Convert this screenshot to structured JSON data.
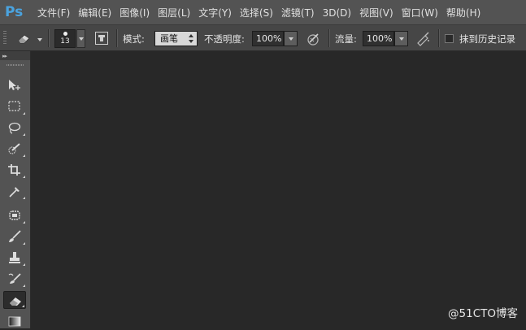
{
  "app": {
    "logo": "Ps"
  },
  "menu": {
    "items": [
      {
        "label": "文件(F)"
      },
      {
        "label": "编辑(E)"
      },
      {
        "label": "图像(I)"
      },
      {
        "label": "图层(L)"
      },
      {
        "label": "文字(Y)"
      },
      {
        "label": "选择(S)"
      },
      {
        "label": "滤镜(T)"
      },
      {
        "label": "3D(D)"
      },
      {
        "label": "视图(V)"
      },
      {
        "label": "窗口(W)"
      },
      {
        "label": "帮助(H)"
      }
    ]
  },
  "options": {
    "tool_icon": "eraser-icon",
    "brush_size": "13",
    "mode_label": "模式:",
    "mode_value": "画笔",
    "opacity_label": "不透明度:",
    "opacity_value": "100%",
    "flow_label": "流量:",
    "flow_value": "100%",
    "erase_history_label": "抹到历史记录",
    "erase_history_checked": false
  },
  "toolbox": {
    "tools": [
      {
        "icon": "move-tool-icon"
      },
      {
        "icon": "marquee-tool-icon"
      },
      {
        "icon": "lasso-tool-icon"
      },
      {
        "icon": "quick-selection-tool-icon"
      },
      {
        "icon": "crop-tool-icon"
      },
      {
        "icon": "eyedropper-tool-icon"
      },
      {
        "icon": "spot-healing-tool-icon"
      },
      {
        "icon": "brush-tool-icon"
      },
      {
        "icon": "clone-stamp-tool-icon"
      },
      {
        "icon": "history-brush-tool-icon"
      },
      {
        "icon": "eraser-tool-icon",
        "active": true
      },
      {
        "icon": "gradient-tool-icon"
      }
    ]
  },
  "watermark": "@51CTO博客",
  "colors": {
    "menubar": "#535353",
    "optionsbar": "#464646",
    "canvas": "#282828",
    "logo": "#4aa3df"
  }
}
